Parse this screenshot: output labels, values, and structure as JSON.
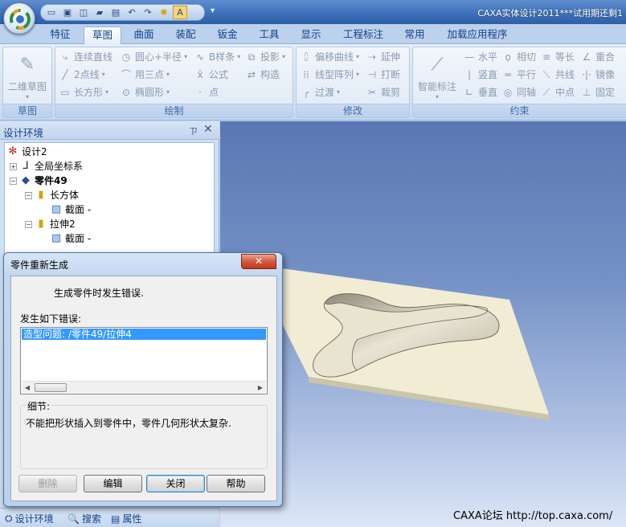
{
  "window": {
    "title": "CAXA实体设计2011***试用期还剩1"
  },
  "quick_access": {
    "icons": [
      "new-icon",
      "open-icon",
      "window-icon",
      "folder-icon",
      "save-icon",
      "undo-icon",
      "redo-icon",
      "bulb-icon",
      "design-icon"
    ],
    "more": "▾"
  },
  "ribbon": {
    "tabs": [
      "特征",
      "草图",
      "曲面",
      "装配",
      "钣金",
      "工具",
      "显示",
      "工程标注",
      "常用",
      "加载应用程序"
    ],
    "active_tab": "草图",
    "groups": {
      "sketch": {
        "label": "草图",
        "big_button": "二维草图"
      },
      "draw": {
        "label": "绘制",
        "items": [
          "连续直线",
          "圆心+半径",
          "B样条",
          "投影",
          "2点线",
          "用三点",
          "公式",
          "构造",
          "长方形",
          "椭圆形",
          "点"
        ]
      },
      "modify": {
        "label": "修改",
        "items": [
          "偏移曲线",
          "延伸",
          "线型阵列",
          "打断",
          "过渡",
          "裁剪"
        ]
      },
      "constraint": {
        "label": "约束",
        "big_button": "智能标注",
        "items": [
          "水平",
          "相切",
          "等长",
          "重合",
          "竖直",
          "平行",
          "共线",
          "镜像",
          "垂直",
          "同轴",
          "中点",
          "固定"
        ]
      }
    }
  },
  "panel": {
    "title": "设计环境",
    "pin": "ㄗ",
    "close": "✕",
    "tree": [
      {
        "label": "设计2",
        "expander": ""
      },
      {
        "label": "全局坐标系",
        "expander": "+"
      },
      {
        "label": "零件49",
        "expander": "−"
      },
      {
        "label": "长方体",
        "expander": "−"
      },
      {
        "label": "截面 -",
        "expander": ""
      },
      {
        "label": "拉伸2",
        "expander": "−"
      },
      {
        "label": "截面 -",
        "expander": ""
      }
    ],
    "bottom_tabs": [
      "设计环境",
      "搜索",
      "属性"
    ]
  },
  "viewport": {
    "footer": "CAXA论坛  http://top.caxa.com/"
  },
  "dialog": {
    "title": "零件重新生成",
    "close_label": "✕",
    "message": "生成零件时发生错误.",
    "errors_label": "发生如下错误:",
    "errors": [
      "造型问题: /零件49/拉伸4"
    ],
    "details_label": "细节:",
    "details_text": "不能把形状插入到零件中，零件几何形状太复杂.",
    "buttons": {
      "delete": "删除",
      "edit": "编辑",
      "close": "关闭",
      "help": "帮助"
    }
  },
  "colors": {
    "accent": "#15428b",
    "selection": "#3399ff",
    "close_button": "#d35a3e"
  }
}
